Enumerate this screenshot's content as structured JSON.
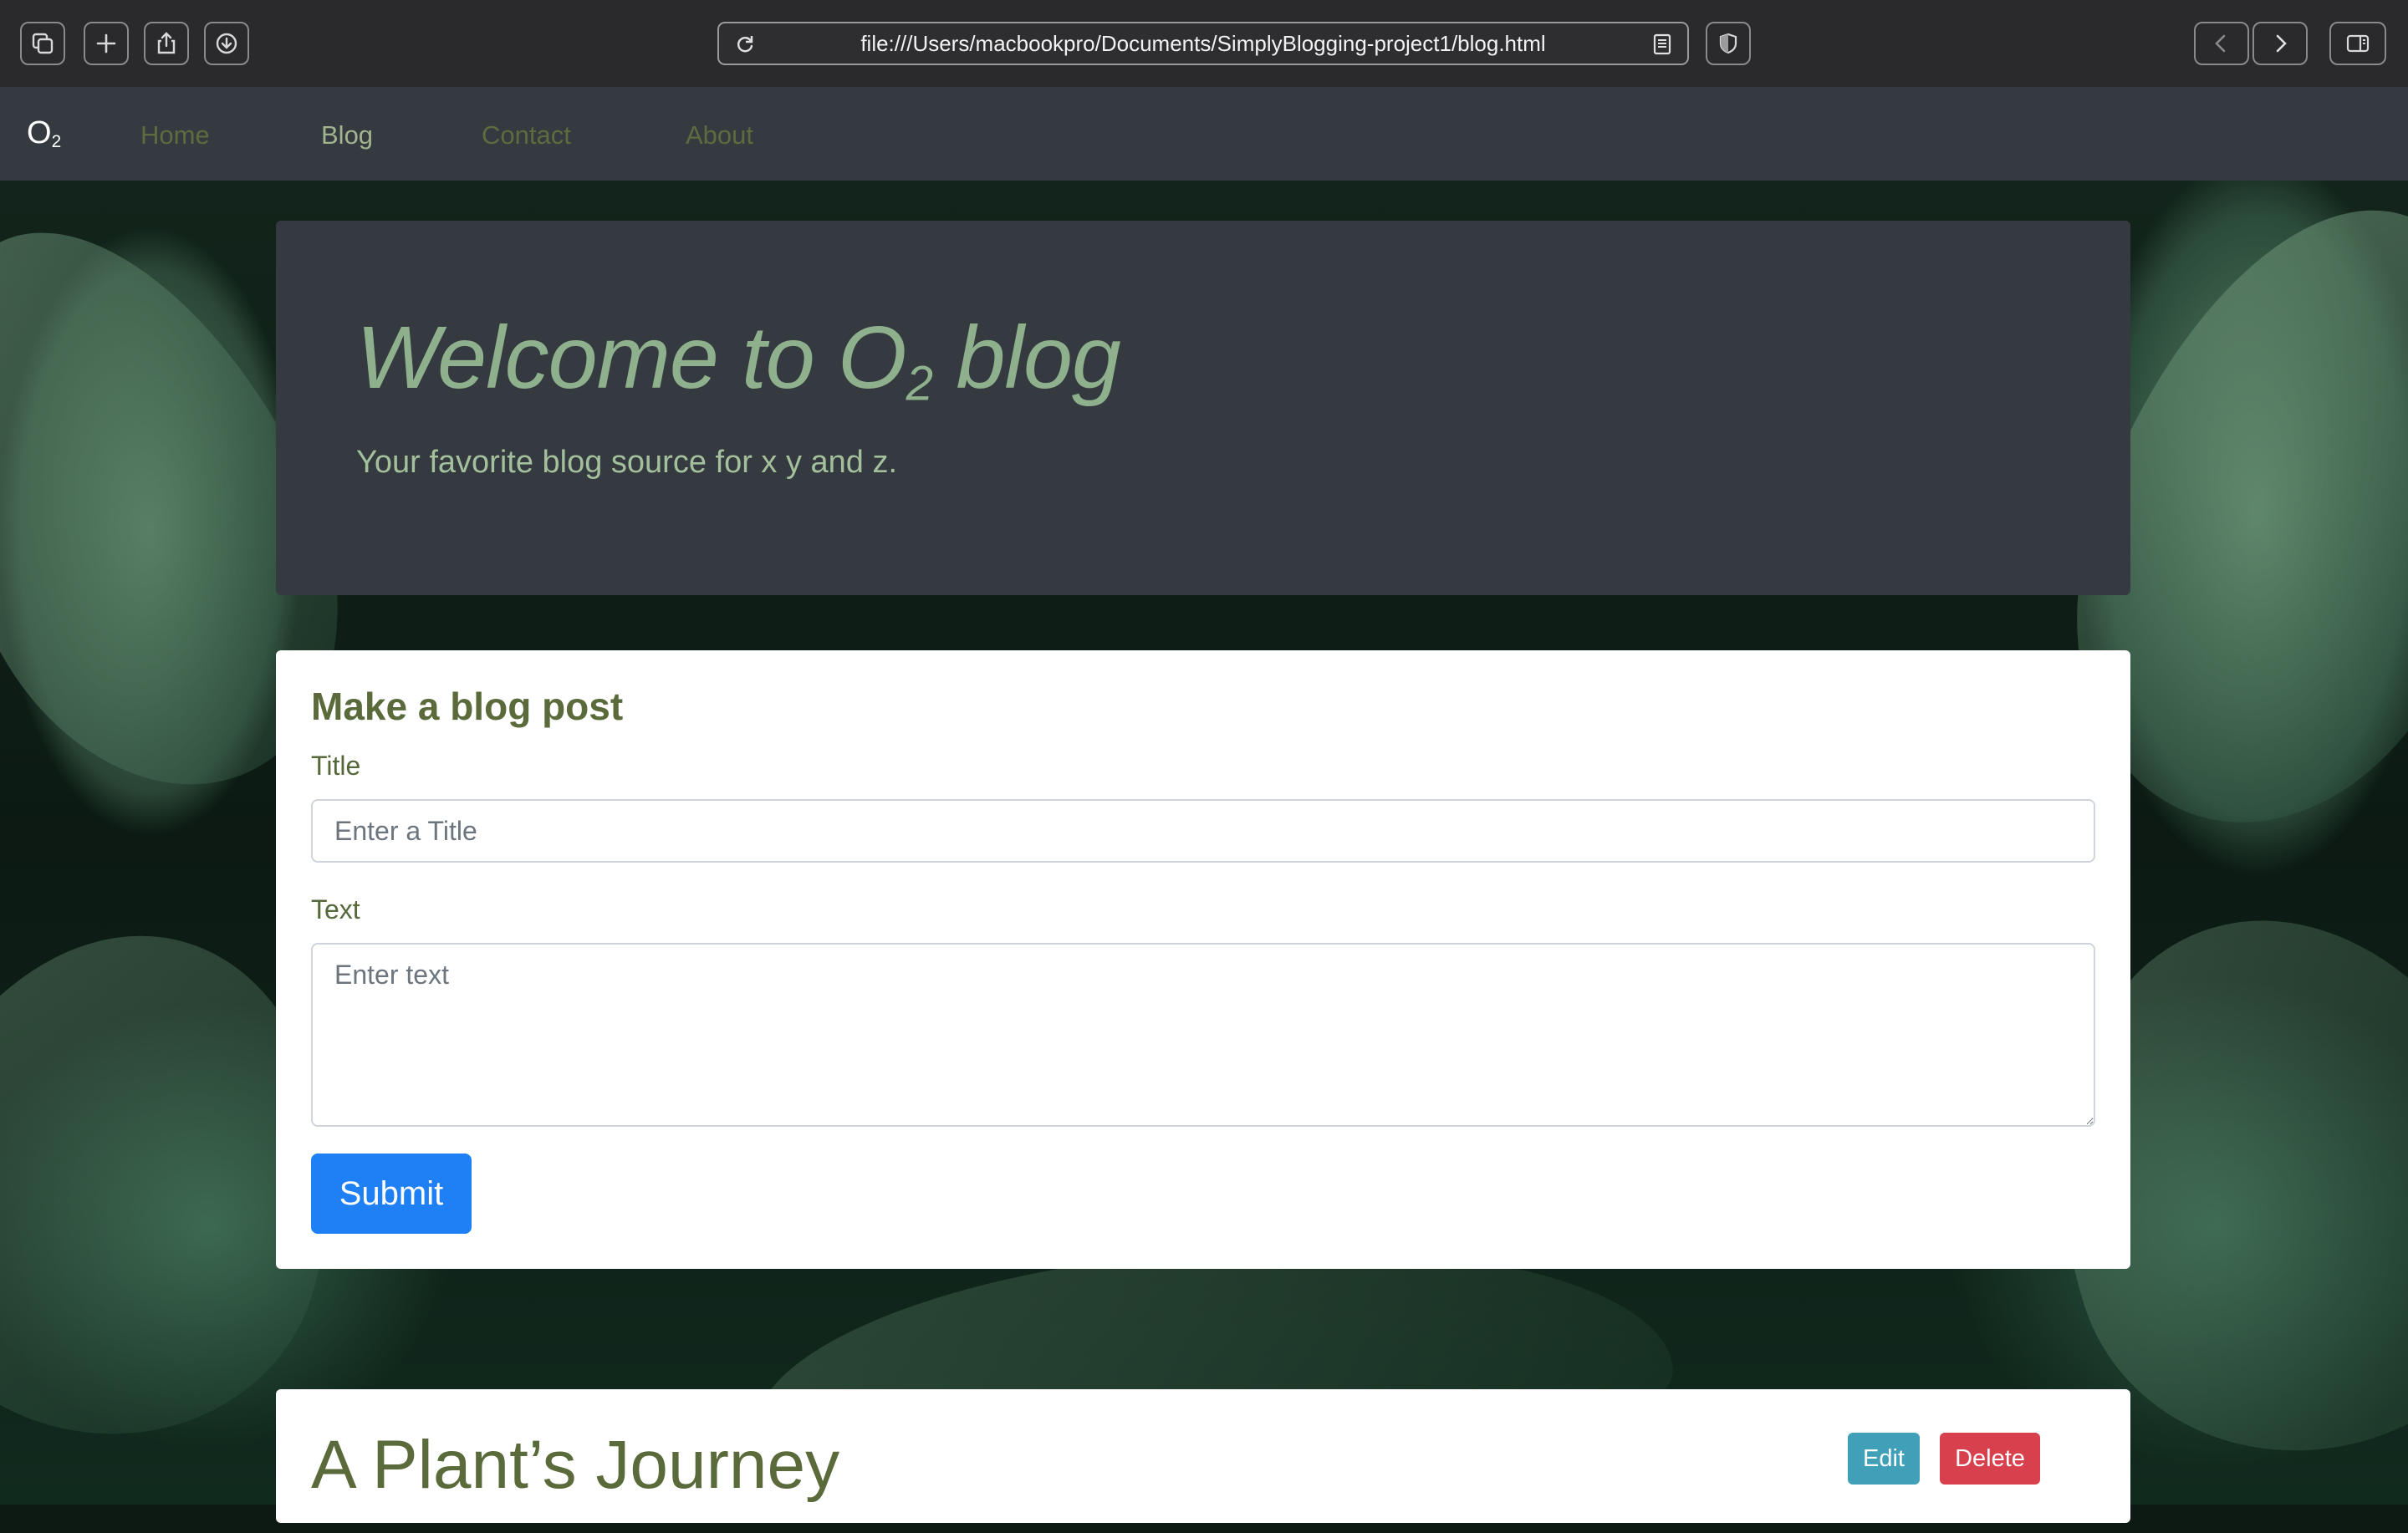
{
  "browser": {
    "url": "file:///Users/macbookpro/Documents/SimplyBlogging-project1/blog.html"
  },
  "nav": {
    "brand": "O",
    "brand_sub": "2",
    "links": [
      {
        "label": "Home",
        "active": false
      },
      {
        "label": "Blog",
        "active": true
      },
      {
        "label": "Contact",
        "active": false
      },
      {
        "label": "About",
        "active": false
      }
    ]
  },
  "hero": {
    "title_prefix": "Welcome to O",
    "title_sub": "2",
    "title_suffix": " blog",
    "subtitle": "Your favorite blog source for x y and z."
  },
  "form": {
    "heading": "Make a blog post",
    "title_label": "Title",
    "title_placeholder": "Enter a Title",
    "title_value": "",
    "text_label": "Text",
    "text_placeholder": "Enter text",
    "text_value": "",
    "submit_label": "Submit"
  },
  "posts": [
    {
      "title": "A Plant’s Journey",
      "edit_label": "Edit",
      "delete_label": "Delete"
    }
  ],
  "colors": {
    "nav_bg": "#343a40",
    "accent_green": "#5a6a3a",
    "hero_text": "#8fb08c",
    "primary": "#1f7ff5",
    "info": "#3fa0b8",
    "danger": "#d9404e"
  },
  "icons": [
    "tab-overview-icon",
    "new-tab-icon",
    "share-icon",
    "download-icon",
    "reload-icon",
    "reader-icon",
    "privacy-shield-icon",
    "back-icon",
    "forward-icon",
    "sidebar-icon"
  ]
}
